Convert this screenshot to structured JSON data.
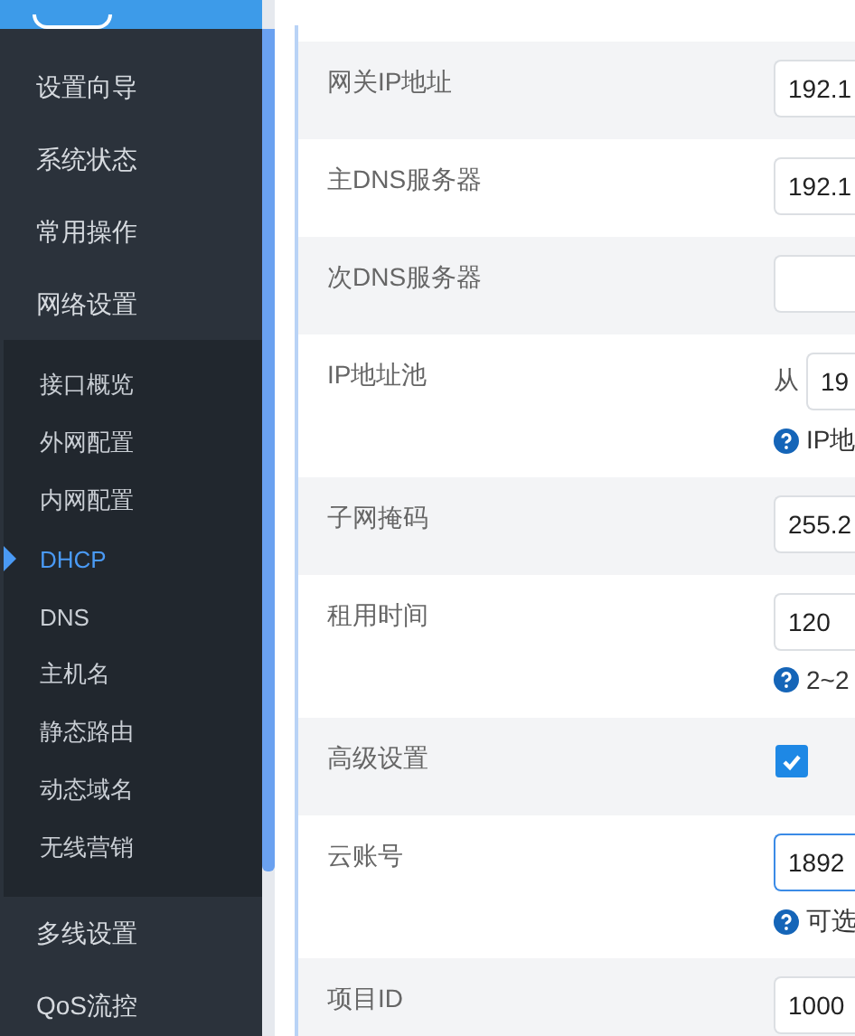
{
  "sidebar": {
    "items": [
      {
        "label": "设置向导",
        "selected": false
      },
      {
        "label": "系统状态",
        "selected": false
      },
      {
        "label": "常用操作",
        "selected": false
      },
      {
        "label": "网络设置",
        "selected": false,
        "expanded": true,
        "children": [
          {
            "label": "接口概览",
            "selected": false
          },
          {
            "label": "外网配置",
            "selected": false
          },
          {
            "label": "内网配置",
            "selected": false
          },
          {
            "label": "DHCP",
            "selected": true
          },
          {
            "label": "DNS",
            "selected": false
          },
          {
            "label": "主机名",
            "selected": false
          },
          {
            "label": "静态路由",
            "selected": false
          },
          {
            "label": "动态域名",
            "selected": false
          },
          {
            "label": "无线营销",
            "selected": false
          }
        ]
      },
      {
        "label": "多线设置",
        "selected": false
      },
      {
        "label": "QoS流控",
        "selected": false
      }
    ]
  },
  "form": {
    "rows": [
      {
        "kind": "input",
        "label": "网关IP地址",
        "value": "192.1",
        "focused": false
      },
      {
        "kind": "input",
        "label": "主DNS服务器",
        "value": "192.1",
        "focused": false
      },
      {
        "kind": "input",
        "label": "次DNS服务器",
        "value": "",
        "focused": false
      },
      {
        "kind": "range",
        "label": "IP地址池",
        "prefix": "从",
        "value": "19",
        "hint": "IP地",
        "focused": false
      },
      {
        "kind": "input",
        "label": "子网掩码",
        "value": "255.2",
        "focused": false
      },
      {
        "kind": "input",
        "label": "租用时间",
        "value": "120",
        "hint": "2~2",
        "focused": false
      },
      {
        "kind": "checkbox",
        "label": "高级设置",
        "checked": true
      },
      {
        "kind": "input",
        "label": "云账号",
        "value": "1892",
        "hint": "可选",
        "focused": true
      },
      {
        "kind": "input",
        "label": "项目ID",
        "value": "1000",
        "focused": false
      }
    ]
  }
}
